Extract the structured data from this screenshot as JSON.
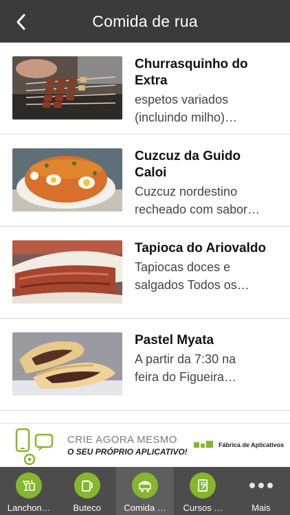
{
  "header": {
    "title": "Comida de rua",
    "back_icon": "chevron-left-icon"
  },
  "items": [
    {
      "name_line1": "Churrasquinho do",
      "name_line2": "Extra",
      "desc_line1": "espetos variados",
      "desc_line2": "(incluindo milho)…"
    },
    {
      "name_line1": "Cuzcuz da Guido",
      "name_line2": "Caloi",
      "desc_line1": "Cuzcuz nordestino",
      "desc_line2": "recheado com sabor…"
    },
    {
      "name_line1": "Tapioca do Ariovaldo",
      "name_line2": "",
      "desc_line1": "Tapiocas doces e",
      "desc_line2": "salgados Todos os…"
    },
    {
      "name_line1": "Pastel Myata",
      "name_line2": "",
      "desc_line1": "A partir da 7:30 na",
      "desc_line2": "feira do Figueira…"
    }
  ],
  "banner": {
    "line1": "CRIE AGORA MESMO",
    "line2": "O SEU PRÓPRIO APLICATIVO!",
    "brand": "Fábrica de Aplicativos"
  },
  "tabs": [
    {
      "label": "Lanchon…",
      "icon": "drinks-icon"
    },
    {
      "label": "Buteco",
      "icon": "beer-mug-icon"
    },
    {
      "label": "Comida …",
      "icon": "food-cart-icon",
      "active": true
    },
    {
      "label": "Cursos …",
      "icon": "notebook-icon"
    },
    {
      "label": "Mais",
      "icon": "more-dots-icon"
    }
  ],
  "colors": {
    "header_bg": "#3b3b3b",
    "tabbar_bg": "#4c4c4c",
    "accent_green": "#86b52e"
  }
}
